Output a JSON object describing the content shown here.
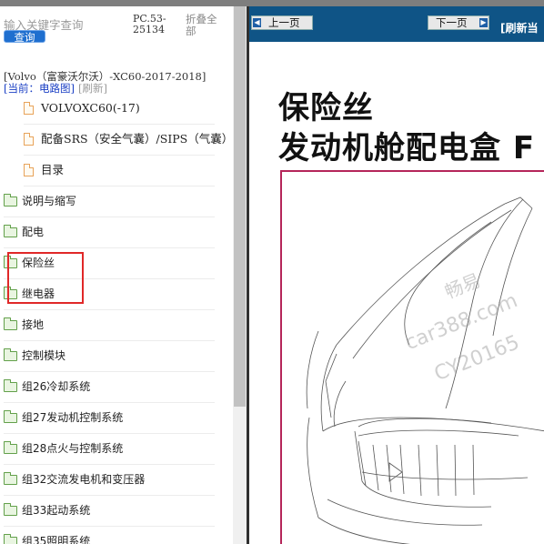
{
  "search": {
    "placeholder": "输入关键字查询",
    "button_label": "查询"
  },
  "doc_code": "PC.53-25134",
  "collapse_all": "折叠全部",
  "model_line": "[Volvo（富豪沃尔沃）-XC60-2017-2018]",
  "current_label": "[当前：电路图]",
  "refresh_link": "[刷新]",
  "tree": [
    {
      "label": "VOLVOXC60(-17)",
      "type": "doc"
    },
    {
      "label": "配备SRS（安全气囊）/SIPS（气囊）",
      "type": "doc"
    },
    {
      "label": "目录",
      "type": "doc"
    },
    {
      "label": "说明与缩写",
      "type": "folder"
    },
    {
      "label": "配电",
      "type": "folder"
    },
    {
      "label": "保险丝",
      "type": "folder"
    },
    {
      "label": "继电器",
      "type": "folder"
    },
    {
      "label": "接地",
      "type": "folder"
    },
    {
      "label": "控制模块",
      "type": "folder"
    },
    {
      "label": "组26冷却系统",
      "type": "folder"
    },
    {
      "label": "组27发动机控制系统",
      "type": "folder"
    },
    {
      "label": "组28点火与控制系统",
      "type": "folder"
    },
    {
      "label": "组32交流发电机和变压器",
      "type": "folder"
    },
    {
      "label": "组33起动系统",
      "type": "folder"
    },
    {
      "label": "组35照明系统",
      "type": "folder"
    }
  ],
  "toolbar": {
    "prev_label": "上一页",
    "next_label": "下一页",
    "refresh_current": "[刷新当"
  },
  "document": {
    "title_line1": "保险丝",
    "title_line2": "发动机舱配电盒 F"
  },
  "watermark": {
    "line1": "畅易",
    "line2": "car388.com",
    "line3": "CY20165"
  },
  "colors": {
    "toolbar_bg": "#0f5486",
    "highlight_border": "#e02828",
    "frame_border": "#b5265a",
    "query_button": "#1f6fcf"
  }
}
